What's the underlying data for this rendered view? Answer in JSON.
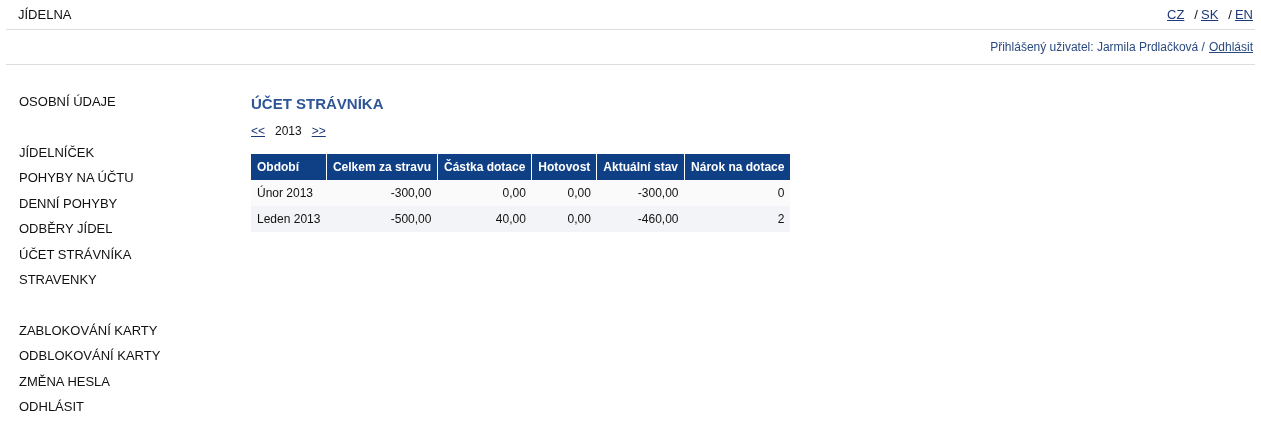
{
  "header": {
    "title": "JÍDELNA",
    "languages": [
      {
        "label": "CZ"
      },
      {
        "label": "SK",
        "separator": "/"
      },
      {
        "label": "EN",
        "separator": "/"
      }
    ]
  },
  "user_bar": {
    "text": "Přihlášený uživatel: Jarmila Prdlačková /",
    "logout": "Odhlásit"
  },
  "sidebar": {
    "groups": [
      {
        "items": [
          "OSOBNÍ ÚDAJE"
        ]
      },
      {
        "items": [
          "JÍDELNÍČEK",
          "POHYBY NA ÚČTU",
          "DENNÍ POHYBY",
          "ODBĚRY JÍDEL",
          "ÚČET STRÁVNÍKA",
          "STRAVENKY"
        ]
      },
      {
        "items": [
          "ZABLOKOVÁNÍ KARTY",
          "ODBLOKOVÁNÍ KARTY",
          "ZMĚNA HESLA",
          "ODHLÁSIT"
        ]
      }
    ]
  },
  "content": {
    "title": "ÚČET STRÁVNÍKA",
    "year_nav": {
      "prev": "<<",
      "year": "2013",
      "next": ">>"
    },
    "table": {
      "columns": [
        "Období",
        "Celkem za stravu",
        "Částka dotace",
        "Hotovost",
        "Aktuální stav",
        "Nárok na dotace"
      ],
      "rows": [
        [
          "Únor 2013",
          "-300,00",
          "0,00",
          "0,00",
          "-300,00",
          "0"
        ],
        [
          "Leden 2013",
          "-500,00",
          "40,00",
          "0,00",
          "-460,00",
          "2"
        ]
      ]
    }
  }
}
